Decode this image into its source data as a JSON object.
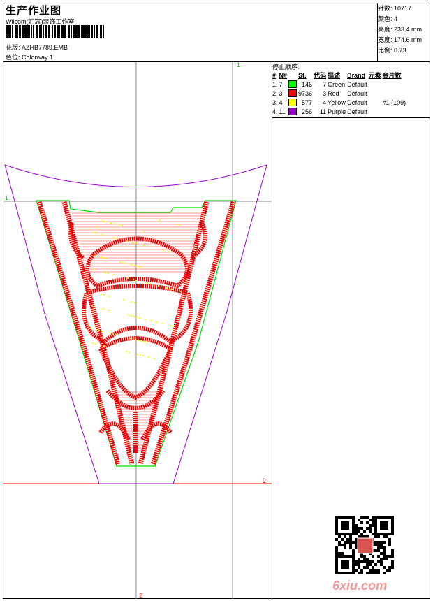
{
  "header": {
    "title": "生产作业图",
    "company": "Wilcom(汇宸)装饰工作室",
    "design_label": "花版:",
    "design_value": "AZHB7789.EMB",
    "colorway_label": "色位:",
    "colorway_value": "Colorway 1"
  },
  "info": [
    {
      "label": "针数:",
      "value": "10717"
    },
    {
      "label": "颜色:",
      "value": "4"
    },
    {
      "label": "高度:",
      "value": "233.4 mm"
    },
    {
      "label": "宽度:",
      "value": "174.6 mm"
    },
    {
      "label": "比例:",
      "value": "0.73"
    }
  ],
  "stop_sequence": {
    "title": "停止顺序:",
    "headers": [
      "#",
      "N#",
      "St.",
      "代码",
      "描述",
      "Brand",
      "元素",
      "金片数"
    ],
    "rows": [
      {
        "idx": "1.",
        "n": "7",
        "color": "#00ff00",
        "st": "146",
        "code": "7",
        "desc": "Green",
        "brand": "Default",
        "element": "",
        "sequins": ""
      },
      {
        "idx": "2.",
        "n": "3",
        "color": "#ff0000",
        "st": "9736",
        "code": "3",
        "desc": "Red",
        "brand": "Default",
        "element": "",
        "sequins": ""
      },
      {
        "idx": "3.",
        "n": "4",
        "color": "#ffff00",
        "st": "577",
        "code": "4",
        "desc": "Yellow",
        "brand": "Default",
        "element": "",
        "sequins": "#1 (109)"
      },
      {
        "idx": "4.",
        "n": "11",
        "color": "#9900cc",
        "st": "256",
        "code": "11",
        "desc": "Purple",
        "brand": "Default",
        "element": "",
        "sequins": ""
      }
    ]
  },
  "guides": {
    "top_marker": "1",
    "left_marker": "1",
    "right_marker": "2",
    "bottom_marker": "2"
  },
  "watermark": "6xiu.com"
}
